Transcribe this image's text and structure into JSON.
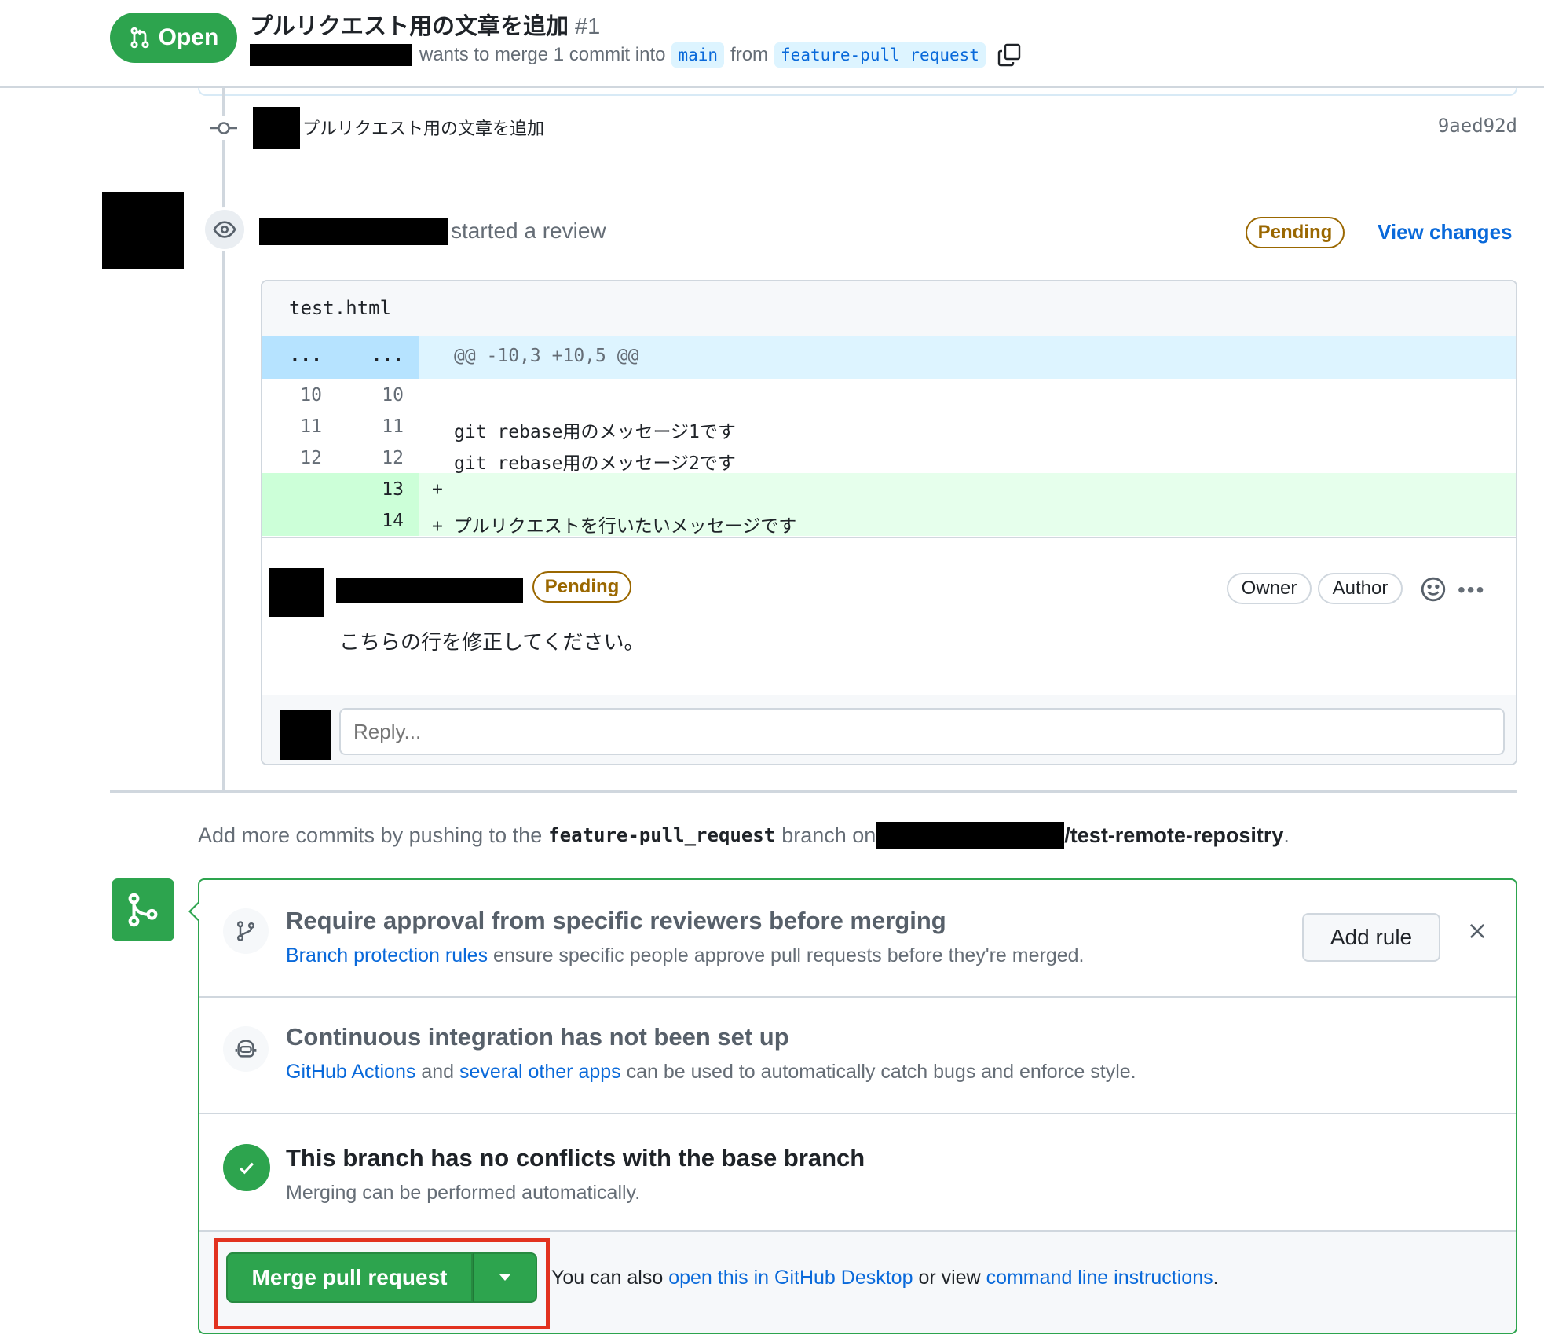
{
  "header": {
    "state": "Open",
    "title": "プルリクエスト用の文章を追加",
    "number": "#1",
    "merge_text": "wants to merge 1 commit into",
    "base_branch": "main",
    "from_text": "from",
    "head_branch": "feature-pull_request"
  },
  "timeline": {
    "commit": {
      "message": "プルリクエスト用の文章を追加",
      "sha": "9aed92d"
    },
    "review": {
      "action": "started a review",
      "status": "Pending",
      "view_changes": "View changes",
      "file_name": "test.html",
      "hunk": {
        "old": "...",
        "new": "...",
        "header": "@@ -10,3 +10,5 @@"
      },
      "lines": [
        {
          "old": "10",
          "new": "10",
          "code": "",
          "type": "context"
        },
        {
          "old": "11",
          "new": "11",
          "code": "git rebase用のメッセージ1です",
          "type": "context"
        },
        {
          "old": "12",
          "new": "12",
          "code": "git rebase用のメッセージ2です",
          "type": "context"
        },
        {
          "old": "",
          "new": "13",
          "code": "+",
          "type": "add"
        },
        {
          "old": "",
          "new": "14",
          "code": "+ プルリクエストを行いたいメッセージです",
          "type": "add"
        }
      ],
      "comment": {
        "status": "Pending",
        "owner_badge": "Owner",
        "author_badge": "Author",
        "body": "こちらの行を修正してください。"
      },
      "reply_placeholder": "Reply..."
    }
  },
  "more_commits": {
    "prefix": "Add more commits by pushing to the",
    "branch": "feature-pull_request",
    "middle": "branch on",
    "repo": "/test-remote-repositry",
    "suffix": "."
  },
  "merge_box": {
    "protection": {
      "title": "Require approval from specific reviewers before merging",
      "link": "Branch protection rules",
      "desc": "ensure specific people approve pull requests before they're merged.",
      "button": "Add rule"
    },
    "ci": {
      "title": "Continuous integration has not been set up",
      "link1": "GitHub Actions",
      "and": "and",
      "link2": "several other apps",
      "desc": "can be used to automatically catch bugs and enforce style."
    },
    "conflicts": {
      "title": "This branch has no conflicts with the base branch",
      "desc": "Merging can be performed automatically."
    },
    "merge": {
      "button": "Merge pull request",
      "note_prefix": "You can also",
      "link1": "open this in GitHub Desktop",
      "or_view": "or view",
      "link2": "command line instructions",
      "suffix": "."
    }
  },
  "colors": {
    "open_green": "#2da44e",
    "pending": "#9a6700",
    "link_blue": "#0969da",
    "highlight_red": "#e2321f"
  }
}
